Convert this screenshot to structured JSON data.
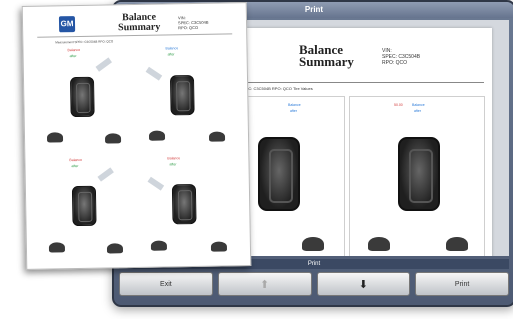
{
  "device": {
    "title": "Print",
    "status": "Print",
    "buttons": [
      {
        "label": "Exit",
        "icon": ""
      },
      {
        "label": "",
        "icon": "arrow-up-icon",
        "glyph": "⬆"
      },
      {
        "label": "",
        "icon": "arrow-down-icon",
        "glyph": "⬇"
      },
      {
        "label": "Print",
        "icon": ""
      }
    ],
    "preview": {
      "title": "Balance\nSummary",
      "vin": "VIN:\nSPEC: C3C504B\nRPO: QCO",
      "heading": "Measurement 1 - SPEC: C3C504B RPO: QCO Tire Values",
      "labels": {
        "balance": "Balance",
        "after": "after",
        "valgrind": "50.00"
      }
    }
  },
  "printout": {
    "logo": "GM",
    "title": "Balance\nSummary",
    "vin": "VIN:\nSPEC: C3C504B\nRPO: QCO",
    "subtitle": "Measurement SPEC: C3C504B RPO: QCO",
    "quadrant_labels": {
      "balance": "Balance",
      "after": "after"
    }
  },
  "colors": {
    "accent": "#2556a5",
    "window": "#4d5a73"
  }
}
